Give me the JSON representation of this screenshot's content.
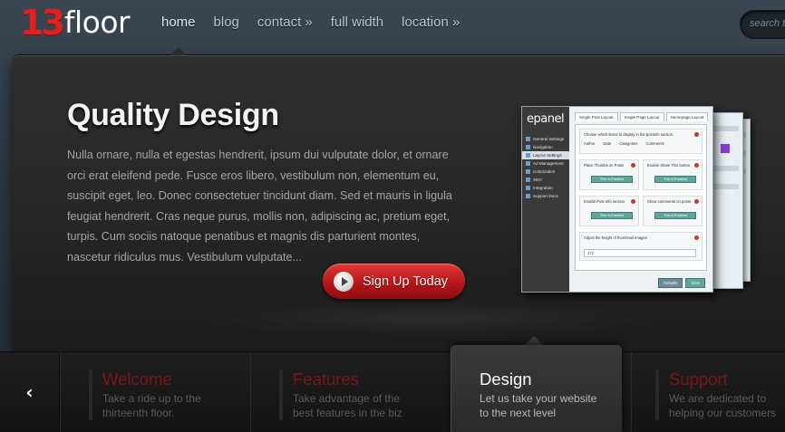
{
  "header": {
    "logo_number": "13",
    "logo_word": "floor",
    "nav": [
      {
        "label": "home",
        "active": true
      },
      {
        "label": "blog",
        "active": false
      },
      {
        "label": "contact »",
        "active": false
      },
      {
        "label": "full width",
        "active": false
      },
      {
        "label": "location »",
        "active": false
      }
    ],
    "search_placeholder": "search th"
  },
  "featured": {
    "title": "Quality Design",
    "text": "Nulla ornare, nulla et egestas hendrerit, ipsum dui vulputate dolor, et ornare orci erat eleifend pede. Fusce eros libero, vestibulum non, elementum eu, suscipit eget, leo. Donec consectetuer tincidunt diam. Sed et mauris in ligula feugiat hendrerit. Cras neque purus, mollis non, adipiscing ac, pretium eget, turpis. Cum sociis natoque penatibus et magnis dis parturient montes, nascetur ridiculus mus. Vestibulum vulputate...",
    "cta_label": "Sign Up Today"
  },
  "epanel": {
    "logo": "epanel",
    "menu": [
      {
        "label": "General Settings",
        "active": false
      },
      {
        "label": "Navigation",
        "active": false
      },
      {
        "label": "Layout Settings",
        "active": true
      },
      {
        "label": "Ad Management",
        "active": false
      },
      {
        "label": "Colorization",
        "active": false
      },
      {
        "label": "SEO",
        "active": false
      },
      {
        "label": "Integration",
        "active": false
      },
      {
        "label": "Support Docs",
        "active": false
      }
    ],
    "tabs": [
      "Single Post Layout",
      "Single Page Layout",
      "Homepage Layout"
    ],
    "row1_title": "Choose which items to display in the postinfo section",
    "checks": [
      "Author",
      "Date",
      "Categories",
      "Comments"
    ],
    "box_titles": [
      "Place Thumbs on Posts",
      "Enable Share This button",
      "Enable Post Info section",
      "Show comments on posts"
    ],
    "enabled_label": "This is Enabled",
    "input_title": "Adjust the height of thumbnail images",
    "input_value": "172",
    "defaults_label": "Defaults",
    "save_label": "Save"
  },
  "slides": [
    {
      "title": "Welcome",
      "line1": "Take a ride up to the",
      "line2": "thirteenth floor.",
      "active": false
    },
    {
      "title": "Features",
      "line1": "Take advantage of the",
      "line2": "best features in the biz",
      "active": false
    },
    {
      "title": "Design",
      "line1": "Let us take your website",
      "line2": "to the next level",
      "active": true
    },
    {
      "title": "Support",
      "line1": "We are dedicated to",
      "line2": "helping our customers",
      "active": false
    }
  ],
  "icons": {
    "prev": "chevron-left-icon",
    "cta": "play-icon"
  },
  "colors": {
    "accent_red": "#e0211f",
    "button_red": "#b5161a",
    "inactive_slide_title": "#7a1717"
  }
}
